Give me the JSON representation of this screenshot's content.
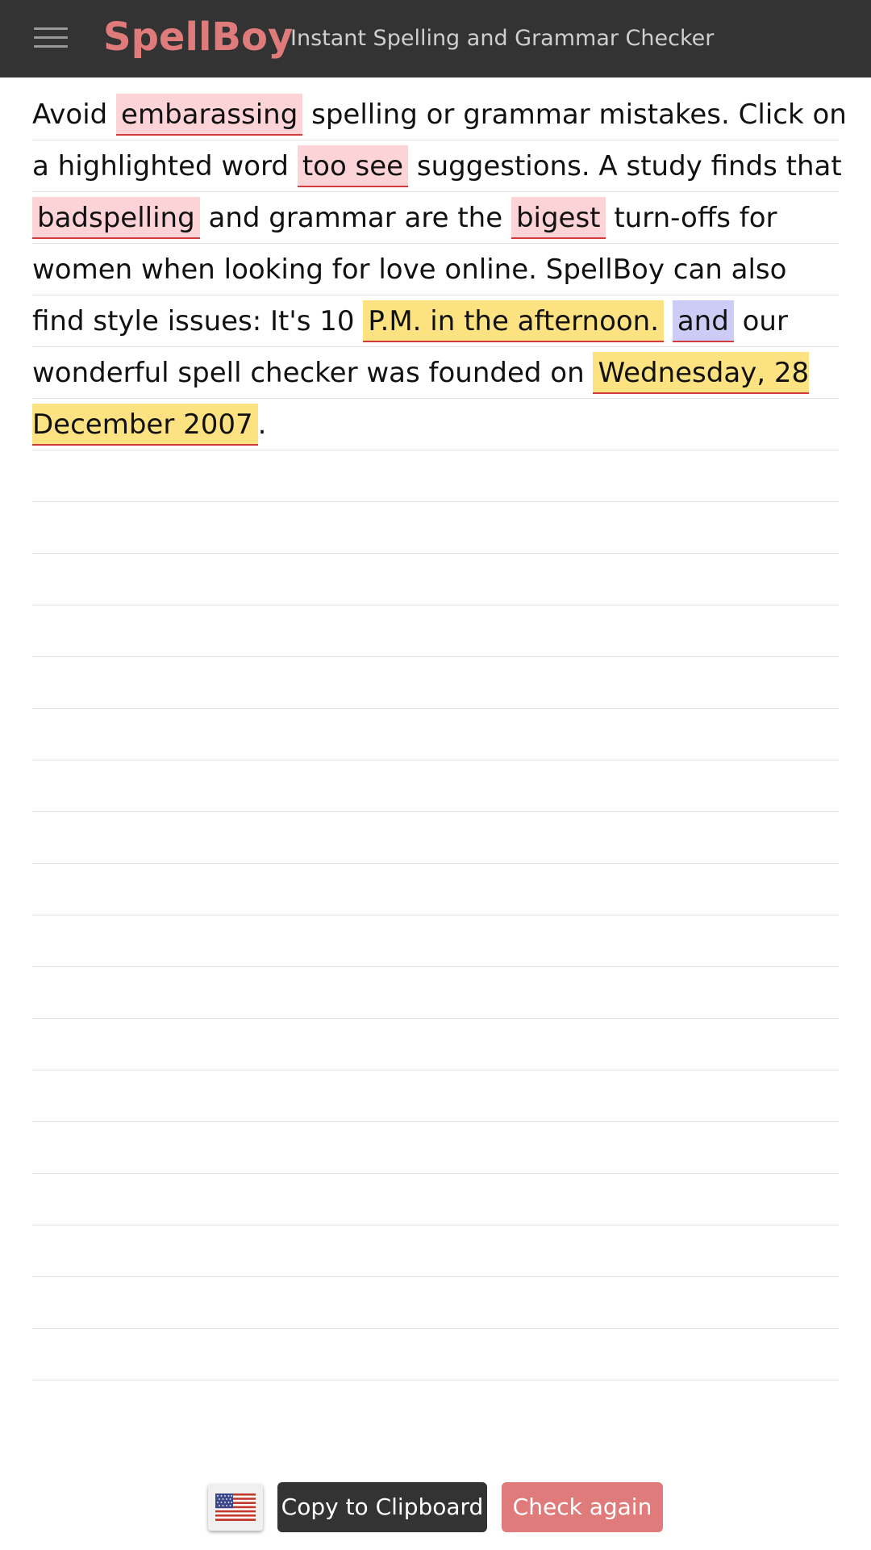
{
  "header": {
    "brand": "SpellBoy",
    "tagline": "Instant Spelling and Grammar Checker",
    "menu_icon": "hamburger-menu-icon"
  },
  "editor": {
    "segments": [
      {
        "text": "Avoid ",
        "type": "plain"
      },
      {
        "text": "embarassing",
        "type": "spell"
      },
      {
        "text": " spelling or grammar mistakes. Click on a highlighted word ",
        "type": "plain"
      },
      {
        "text": "too see",
        "type": "spell"
      },
      {
        "text": " suggestions. A study finds that ",
        "type": "plain"
      },
      {
        "text": "badspelling",
        "type": "spell"
      },
      {
        "text": " and grammar are the ",
        "type": "plain"
      },
      {
        "text": "bigest",
        "type": "spell"
      },
      {
        "text": " turn-offs for women when looking for love online. SpellBoy can also find style issues: It's 10 ",
        "type": "plain"
      },
      {
        "text": "P.M. in the afternoon.",
        "type": "style"
      },
      {
        "text": " ",
        "type": "plain"
      },
      {
        "text": "and",
        "type": "grammar"
      },
      {
        "text": " our wonderful spell checker was founded on ",
        "type": "plain"
      },
      {
        "text": "Wednesday, 28 December 2007",
        "type": "style"
      },
      {
        "text": ".",
        "type": "plain"
      }
    ]
  },
  "footer": {
    "language_icon": "us-flag-icon",
    "copy_label": "Copy to Clipboard",
    "check_label": "Check again"
  },
  "colors": {
    "header_bg": "#333333",
    "brand": "#e07b7b",
    "spell_highlight": "#fcd3d6",
    "style_highlight": "#fde281",
    "grammar_highlight": "#cdccf6",
    "underline": "#d23b3b"
  }
}
